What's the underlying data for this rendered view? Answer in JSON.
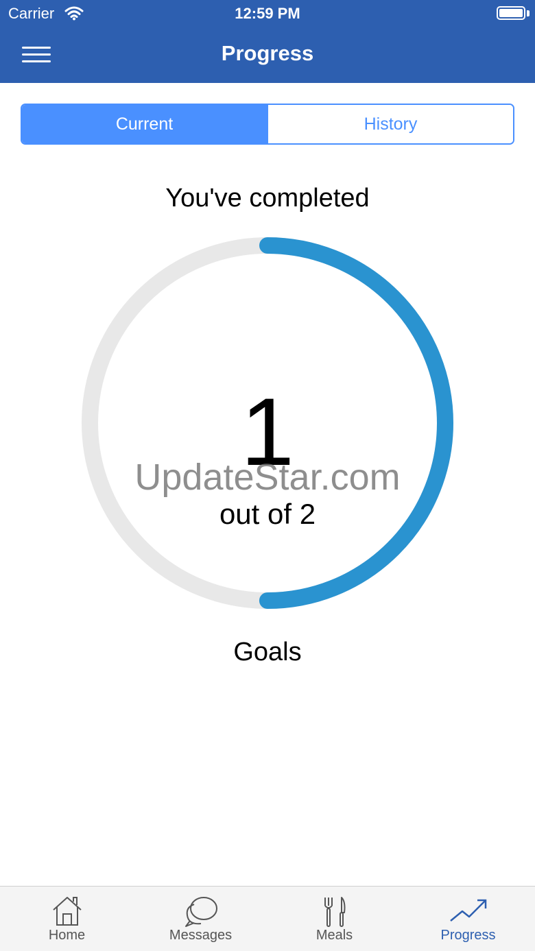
{
  "status_bar": {
    "carrier": "Carrier",
    "time": "12:59 PM"
  },
  "header": {
    "title": "Progress",
    "menu_icon": "hamburger-menu-icon"
  },
  "segments": {
    "current": "Current",
    "history": "History",
    "selected": "Current"
  },
  "progress": {
    "heading": "You've completed",
    "completed": "1",
    "out_of": "out of 2",
    "label": "Goals",
    "fraction": 0.5,
    "ring_color": "#2a93d0",
    "track_color": "#e8e8e8"
  },
  "watermark": "UpdateStar.com",
  "tabs": [
    {
      "label": "Home",
      "icon": "home-icon"
    },
    {
      "label": "Messages",
      "icon": "chat-bubbles-icon"
    },
    {
      "label": "Meals",
      "icon": "fork-knife-icon"
    },
    {
      "label": "Progress",
      "icon": "trend-up-icon",
      "active": true
    }
  ],
  "colors": {
    "header": "#2d5fb0",
    "accent": "#4a90ff"
  }
}
